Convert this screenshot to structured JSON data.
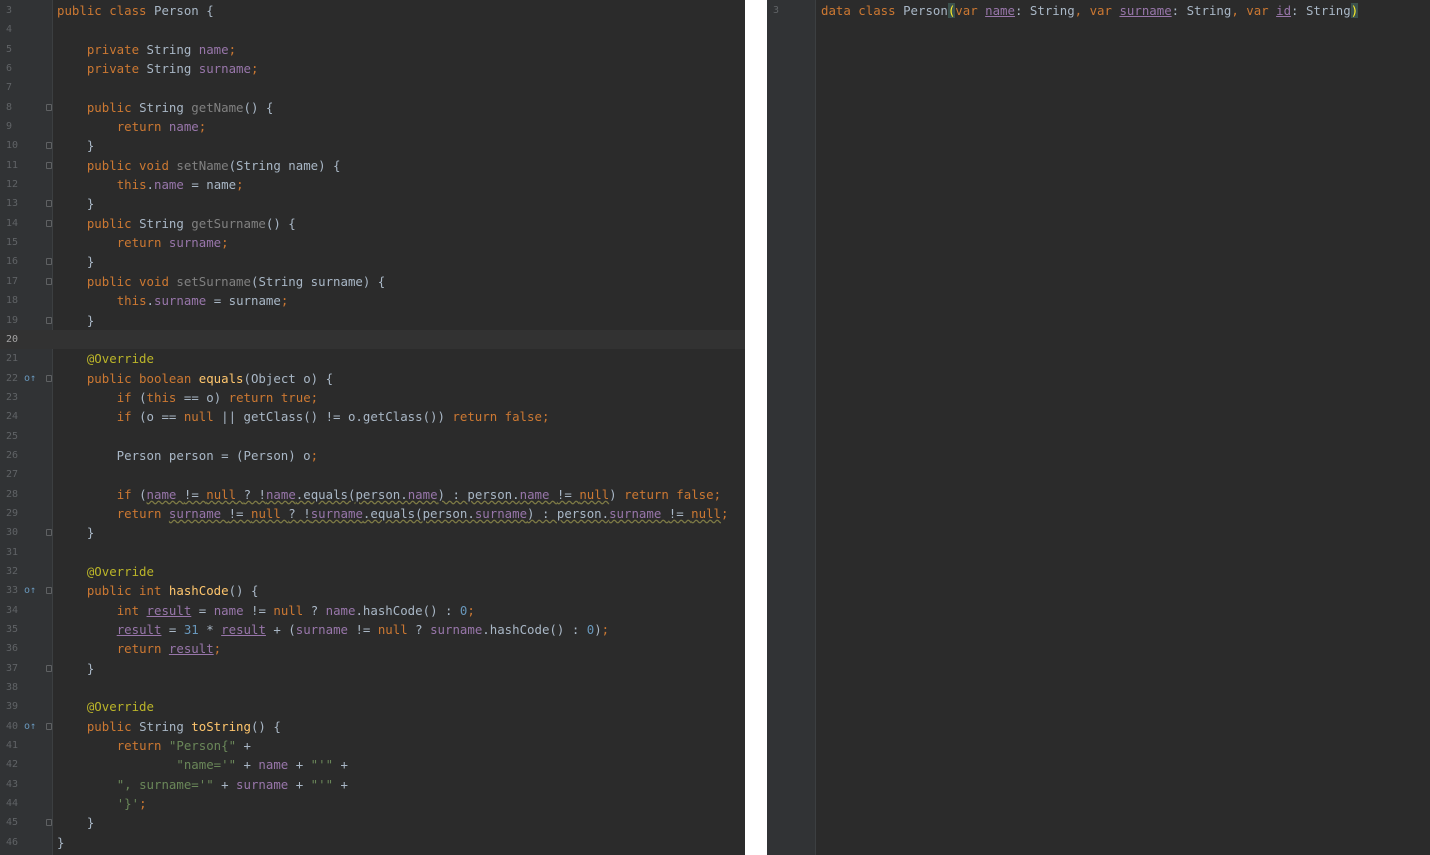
{
  "left_editor": {
    "lines": [
      {
        "num": "3",
        "code": [
          [
            "k",
            "public class "
          ],
          [
            "p",
            "Person "
          ],
          [
            "p",
            "{"
          ]
        ]
      },
      {
        "num": "4",
        "code": []
      },
      {
        "num": "5",
        "code": [
          [
            "p",
            "    "
          ],
          [
            "k",
            "private "
          ],
          [
            "p",
            "String "
          ],
          [
            "f",
            "name"
          ],
          [
            "k",
            ";"
          ]
        ]
      },
      {
        "num": "6",
        "code": [
          [
            "p",
            "    "
          ],
          [
            "k",
            "private "
          ],
          [
            "p",
            "String "
          ],
          [
            "f",
            "surname"
          ],
          [
            "k",
            ";"
          ]
        ]
      },
      {
        "num": "7",
        "code": []
      },
      {
        "num": "8",
        "code": [
          [
            "p",
            "    "
          ],
          [
            "k",
            "public "
          ],
          [
            "p",
            "String "
          ],
          [
            "fd",
            "getName"
          ],
          [
            "p",
            "() {"
          ]
        ]
      },
      {
        "num": "9",
        "code": [
          [
            "p",
            "        "
          ],
          [
            "k",
            "return "
          ],
          [
            "f",
            "name"
          ],
          [
            "k",
            ";"
          ]
        ]
      },
      {
        "num": "10",
        "code": [
          [
            "p",
            "    }"
          ]
        ]
      },
      {
        "num": "11",
        "code": [
          [
            "p",
            "    "
          ],
          [
            "k",
            "public void "
          ],
          [
            "fd",
            "setName"
          ],
          [
            "p",
            "(String name) {"
          ]
        ]
      },
      {
        "num": "12",
        "code": [
          [
            "p",
            "        "
          ],
          [
            "k",
            "this"
          ],
          [
            "p",
            "."
          ],
          [
            "f",
            "name "
          ],
          [
            "p",
            "= name"
          ],
          [
            "k",
            ";"
          ]
        ]
      },
      {
        "num": "13",
        "code": [
          [
            "p",
            "    }"
          ]
        ]
      },
      {
        "num": "14",
        "code": [
          [
            "p",
            "    "
          ],
          [
            "k",
            "public "
          ],
          [
            "p",
            "String "
          ],
          [
            "fd",
            "getSurname"
          ],
          [
            "p",
            "() {"
          ]
        ]
      },
      {
        "num": "15",
        "code": [
          [
            "p",
            "        "
          ],
          [
            "k",
            "return "
          ],
          [
            "f",
            "surname"
          ],
          [
            "k",
            ";"
          ]
        ]
      },
      {
        "num": "16",
        "code": [
          [
            "p",
            "    }"
          ]
        ]
      },
      {
        "num": "17",
        "code": [
          [
            "p",
            "    "
          ],
          [
            "k",
            "public void "
          ],
          [
            "fd",
            "setSurname"
          ],
          [
            "p",
            "(String surname) {"
          ]
        ]
      },
      {
        "num": "18",
        "code": [
          [
            "p",
            "        "
          ],
          [
            "k",
            "this"
          ],
          [
            "p",
            "."
          ],
          [
            "f",
            "surname "
          ],
          [
            "p",
            "= surname"
          ],
          [
            "k",
            ";"
          ]
        ]
      },
      {
        "num": "19",
        "code": [
          [
            "p",
            "    }"
          ]
        ]
      },
      {
        "num": "20",
        "code": [],
        "current": true
      },
      {
        "num": "21",
        "code": [
          [
            "p",
            "    "
          ],
          [
            "a",
            "@Override"
          ]
        ]
      },
      {
        "num": "22",
        "code": [
          [
            "p",
            "    "
          ],
          [
            "k",
            "public boolean "
          ],
          [
            "m",
            "equals"
          ],
          [
            "p",
            "(Object o) {"
          ]
        ],
        "marker": "o↑"
      },
      {
        "num": "23",
        "code": [
          [
            "p",
            "        "
          ],
          [
            "k",
            "if "
          ],
          [
            "p",
            "("
          ],
          [
            "k",
            "this "
          ],
          [
            "p",
            "== o) "
          ],
          [
            "k",
            "return true;"
          ]
        ]
      },
      {
        "num": "24",
        "code": [
          [
            "p",
            "        "
          ],
          [
            "k",
            "if "
          ],
          [
            "p",
            "(o == "
          ],
          [
            "k",
            "null "
          ],
          [
            "p",
            "|| getClass() != o.getClass()) "
          ],
          [
            "k",
            "return false;"
          ]
        ]
      },
      {
        "num": "25",
        "code": []
      },
      {
        "num": "26",
        "code": [
          [
            "p",
            "        Person person = (Person) o"
          ],
          [
            "k",
            ";"
          ]
        ]
      },
      {
        "num": "27",
        "code": []
      },
      {
        "num": "28",
        "code": [
          [
            "p",
            "        "
          ],
          [
            "k",
            "if "
          ],
          [
            "p",
            "("
          ],
          [
            "fw",
            "name "
          ],
          [
            "pw",
            "!= "
          ],
          [
            "kw",
            "null "
          ],
          [
            "pw",
            "? !"
          ],
          [
            "fw",
            "name"
          ],
          [
            "pw",
            ".equals(person."
          ],
          [
            "fw",
            "name"
          ],
          [
            "pw",
            ") : person."
          ],
          [
            "fw",
            "name "
          ],
          [
            "pw",
            "!= "
          ],
          [
            "kw",
            "null"
          ],
          [
            "p",
            ") "
          ],
          [
            "k",
            "return false;"
          ]
        ]
      },
      {
        "num": "29",
        "code": [
          [
            "p",
            "        "
          ],
          [
            "k",
            "return "
          ],
          [
            "fw",
            "surname "
          ],
          [
            "pw",
            "!= "
          ],
          [
            "kw",
            "null "
          ],
          [
            "pw",
            "? !"
          ],
          [
            "fw",
            "surname"
          ],
          [
            "pw",
            ".equals(person."
          ],
          [
            "fw",
            "surname"
          ],
          [
            "pw",
            ") : person."
          ],
          [
            "fw",
            "surname "
          ],
          [
            "pw",
            "!= "
          ],
          [
            "kw",
            "null"
          ],
          [
            "k",
            ";"
          ]
        ]
      },
      {
        "num": "30",
        "code": [
          [
            "p",
            "    }"
          ]
        ]
      },
      {
        "num": "31",
        "code": []
      },
      {
        "num": "32",
        "code": [
          [
            "p",
            "    "
          ],
          [
            "a",
            "@Override"
          ]
        ]
      },
      {
        "num": "33",
        "code": [
          [
            "p",
            "    "
          ],
          [
            "k",
            "public int "
          ],
          [
            "m",
            "hashCode"
          ],
          [
            "p",
            "() {"
          ]
        ],
        "marker": "o↑"
      },
      {
        "num": "34",
        "code": [
          [
            "p",
            "        "
          ],
          [
            "k",
            "int "
          ],
          [
            "u",
            "result"
          ],
          [
            "p",
            " = "
          ],
          [
            "f",
            "name "
          ],
          [
            "p",
            "!= "
          ],
          [
            "k",
            "null "
          ],
          [
            "p",
            "? "
          ],
          [
            "f",
            "name"
          ],
          [
            "p",
            ".hashCode() : "
          ],
          [
            "n",
            "0"
          ],
          [
            "k",
            ";"
          ]
        ]
      },
      {
        "num": "35",
        "code": [
          [
            "p",
            "        "
          ],
          [
            "u",
            "result"
          ],
          [
            "p",
            " = "
          ],
          [
            "n",
            "31 "
          ],
          [
            "p",
            "* "
          ],
          [
            "u",
            "result"
          ],
          [
            "p",
            " + ("
          ],
          [
            "f",
            "surname "
          ],
          [
            "p",
            "!= "
          ],
          [
            "k",
            "null "
          ],
          [
            "p",
            "? "
          ],
          [
            "f",
            "surname"
          ],
          [
            "p",
            ".hashCode() : "
          ],
          [
            "n",
            "0"
          ],
          [
            "p",
            ")"
          ],
          [
            "k",
            ";"
          ]
        ]
      },
      {
        "num": "36",
        "code": [
          [
            "p",
            "        "
          ],
          [
            "k",
            "return "
          ],
          [
            "u",
            "result"
          ],
          [
            "k",
            ";"
          ]
        ]
      },
      {
        "num": "37",
        "code": [
          [
            "p",
            "    }"
          ]
        ]
      },
      {
        "num": "38",
        "code": []
      },
      {
        "num": "39",
        "code": [
          [
            "p",
            "    "
          ],
          [
            "a",
            "@Override"
          ]
        ]
      },
      {
        "num": "40",
        "code": [
          [
            "p",
            "    "
          ],
          [
            "k",
            "public "
          ],
          [
            "p",
            "String "
          ],
          [
            "m",
            "toString"
          ],
          [
            "p",
            "() {"
          ]
        ],
        "marker": "o↑"
      },
      {
        "num": "41",
        "code": [
          [
            "p",
            "        "
          ],
          [
            "k",
            "return "
          ],
          [
            "s",
            "\"Person{\" "
          ],
          [
            "p",
            "+"
          ]
        ]
      },
      {
        "num": "42",
        "code": [
          [
            "p",
            "                "
          ],
          [
            "s",
            "\"name='\" "
          ],
          [
            "p",
            "+ "
          ],
          [
            "f",
            "name "
          ],
          [
            "p",
            "+ "
          ],
          [
            "s",
            "\"'\" "
          ],
          [
            "p",
            "+"
          ]
        ]
      },
      {
        "num": "43",
        "code": [
          [
            "p",
            "        "
          ],
          [
            "s",
            "\", surname='\" "
          ],
          [
            "p",
            "+ "
          ],
          [
            "f",
            "surname "
          ],
          [
            "p",
            "+ "
          ],
          [
            "s",
            "\"'\" "
          ],
          [
            "p",
            "+"
          ]
        ]
      },
      {
        "num": "44",
        "code": [
          [
            "p",
            "        "
          ],
          [
            "s",
            "'}'"
          ],
          [
            "k",
            ";"
          ]
        ]
      },
      {
        "num": "45",
        "code": [
          [
            "p",
            "    }"
          ]
        ]
      },
      {
        "num": "46",
        "code": [
          [
            "p",
            "}"
          ]
        ]
      }
    ]
  },
  "right_editor": {
    "lines": [
      {
        "num": "3",
        "code": [
          [
            "k",
            "data class "
          ],
          [
            "p",
            "Person"
          ],
          [
            "bm",
            "("
          ],
          [
            "k",
            "var "
          ],
          [
            "fu",
            "name"
          ],
          [
            "p",
            ": String"
          ],
          [
            "k",
            ", var "
          ],
          [
            "fu",
            "surname"
          ],
          [
            "p",
            ": String"
          ],
          [
            "k",
            ", var "
          ],
          [
            "fu",
            "id"
          ],
          [
            "p",
            ": String"
          ],
          [
            "bm",
            ")"
          ]
        ]
      }
    ]
  },
  "colors": {
    "background": "#2b2b2b",
    "gutter": "#313335",
    "keyword": "#cc7832",
    "field": "#9876aa",
    "method": "#ffc66d",
    "number": "#6897bb",
    "string": "#6a8759",
    "annotation": "#bbb529",
    "plain": "#a9b7c6"
  }
}
